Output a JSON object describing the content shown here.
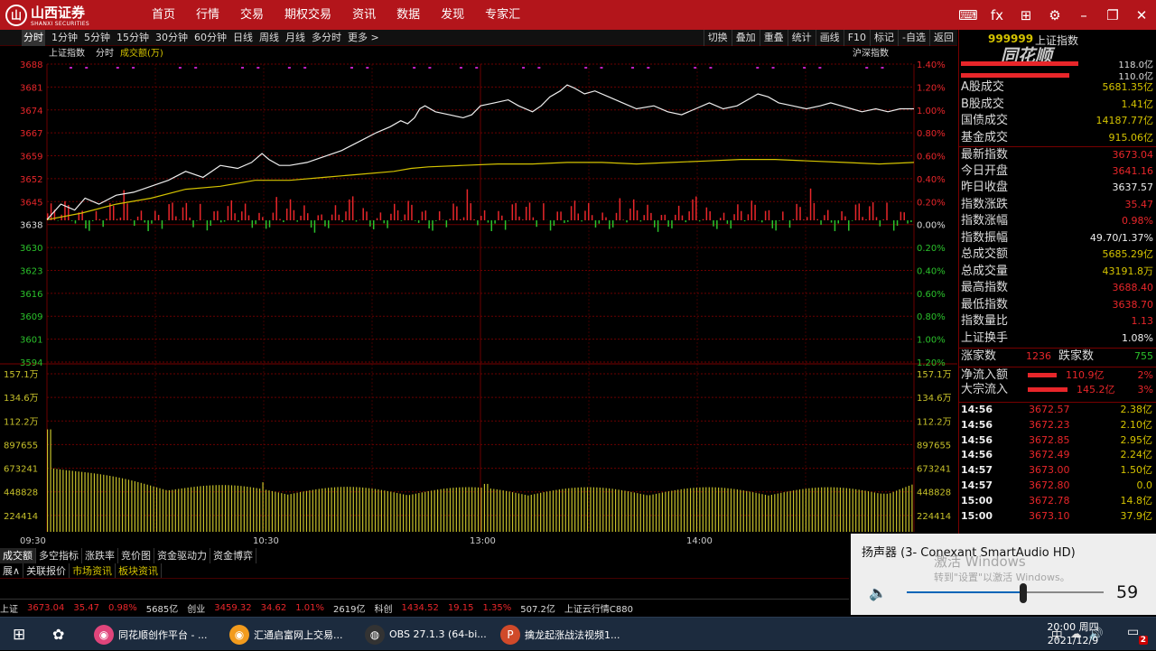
{
  "app": {
    "logo_mark": "山",
    "logo_name": "山西证券",
    "logo_sub": "SHANXI SECURITIES"
  },
  "nav": [
    "首页",
    "行情",
    "交易",
    "期权交易",
    "资讯",
    "数据",
    "发现",
    "专家汇"
  ],
  "top_icons": [
    "keyboard-icon",
    "fx-icon",
    "grid-icon",
    "gear-icon",
    "minimize-icon",
    "restore-icon",
    "close-icon"
  ],
  "top_icon_glyphs": [
    "⌨",
    "fx",
    "⊞",
    "⚙",
    "–",
    "❐",
    "✕"
  ],
  "periods": [
    "分时",
    "1分钟",
    "5分钟",
    "15分钟",
    "30分钟",
    "60分钟",
    "日线",
    "周线",
    "月线",
    "多分时",
    "更多 >"
  ],
  "tools": [
    "切换",
    "叠加",
    "重叠",
    "统计",
    "画线",
    "F10",
    "标记",
    "-自选",
    "返回"
  ],
  "chart": {
    "index_name": "上证指数",
    "mode": "分时",
    "vol_label": "成交额(万)",
    "compare_label": "沪深指数"
  },
  "colors": {
    "up": "#e8262a",
    "down": "#2bc12b",
    "vol": "#c7c12a",
    "line_white": "#eeeeee",
    "line_yellow": "#d4c300",
    "grid": "#6b0000"
  },
  "chart_data": {
    "type": "line",
    "title": "上证指数",
    "yaxis_left": [
      "3688",
      "3681",
      "3674",
      "3667",
      "3659",
      "3652",
      "3645",
      "3638",
      "3630",
      "3623",
      "3616",
      "3609",
      "3601",
      "3594"
    ],
    "yaxis_right": [
      "1.40%",
      "1.20%",
      "1.00%",
      "0.80%",
      "0.60%",
      "0.40%",
      "0.20%",
      "0.00%",
      "0.20%",
      "0.40%",
      "0.60%",
      "0.80%",
      "1.00%",
      "1.20%"
    ],
    "vol_axis": [
      "157.1万",
      "134.6万",
      "112.2万",
      "897655",
      "673241",
      "448828",
      "224414"
    ],
    "x_labels": [
      "09:30",
      "10:30",
      "13:00",
      "14:00"
    ],
    "prev_close": 3637.57,
    "ylim": [
      3590,
      3690
    ],
    "price_series": [
      [
        0,
        3637.8
      ],
      [
        8,
        3643
      ],
      [
        16,
        3641
      ],
      [
        22,
        3645
      ],
      [
        30,
        3643
      ],
      [
        40,
        3646
      ],
      [
        50,
        3647
      ],
      [
        60,
        3649
      ],
      [
        70,
        3651
      ],
      [
        80,
        3654
      ],
      [
        90,
        3652
      ],
      [
        100,
        3656
      ],
      [
        110,
        3655
      ],
      [
        118,
        3657
      ],
      [
        124,
        3660
      ],
      [
        128,
        3658
      ],
      [
        134,
        3656
      ],
      [
        140,
        3656
      ],
      [
        150,
        3657
      ],
      [
        160,
        3659
      ],
      [
        170,
        3661
      ],
      [
        180,
        3664
      ],
      [
        190,
        3667
      ],
      [
        198,
        3669
      ],
      [
        204,
        3671
      ],
      [
        208,
        3670
      ],
      [
        212,
        3672
      ],
      [
        215,
        3675
      ],
      [
        218,
        3676
      ],
      [
        224,
        3674
      ],
      [
        232,
        3673
      ],
      [
        240,
        3672
      ],
      [
        245,
        3673
      ],
      [
        250,
        3676
      ],
      [
        258,
        3677
      ],
      [
        266,
        3678
      ],
      [
        272,
        3676
      ],
      [
        280,
        3674
      ],
      [
        285,
        3676
      ],
      [
        290,
        3679
      ],
      [
        296,
        3681
      ],
      [
        300,
        3683
      ],
      [
        304,
        3682
      ],
      [
        310,
        3680
      ],
      [
        316,
        3681
      ],
      [
        324,
        3679
      ],
      [
        332,
        3677
      ],
      [
        340,
        3675
      ],
      [
        350,
        3676
      ],
      [
        358,
        3674
      ],
      [
        366,
        3673
      ],
      [
        374,
        3675
      ],
      [
        382,
        3677
      ],
      [
        390,
        3675
      ],
      [
        398,
        3676
      ],
      [
        404,
        3678
      ],
      [
        410,
        3680
      ],
      [
        416,
        3679
      ],
      [
        422,
        3677
      ],
      [
        430,
        3676
      ],
      [
        438,
        3675
      ],
      [
        446,
        3676
      ],
      [
        452,
        3677
      ],
      [
        458,
        3676
      ],
      [
        464,
        3675
      ],
      [
        470,
        3674
      ],
      [
        478,
        3675
      ],
      [
        485,
        3674
      ],
      [
        492,
        3675
      ],
      [
        500,
        3675
      ]
    ],
    "avg_series": [
      [
        0,
        3637.8
      ],
      [
        20,
        3640
      ],
      [
        40,
        3643
      ],
      [
        60,
        3645
      ],
      [
        80,
        3648
      ],
      [
        100,
        3649
      ],
      [
        120,
        3651
      ],
      [
        140,
        3651
      ],
      [
        160,
        3652
      ],
      [
        180,
        3653
      ],
      [
        200,
        3654
      ],
      [
        210,
        3655
      ],
      [
        220,
        3655.5
      ],
      [
        240,
        3656
      ],
      [
        260,
        3656.5
      ],
      [
        280,
        3656.5
      ],
      [
        300,
        3657
      ],
      [
        320,
        3657
      ],
      [
        340,
        3656.5
      ],
      [
        360,
        3657
      ],
      [
        380,
        3657.5
      ],
      [
        400,
        3658
      ],
      [
        420,
        3658
      ],
      [
        440,
        3657.5
      ],
      [
        460,
        3657
      ],
      [
        480,
        3656.5
      ],
      [
        500,
        3657
      ]
    ]
  },
  "right": {
    "code": "999999",
    "name": "上证指数",
    "brand": "同花顺",
    "bar1_value": "118.0亿",
    "bar2_value": "110.0亿",
    "stats": [
      {
        "k": "A股成交",
        "v": "5681.35亿",
        "c": "#d4c300"
      },
      {
        "k": "B股成交",
        "v": "1.41亿",
        "c": "#d4c300"
      },
      {
        "k": "国债成交",
        "v": "14187.77亿",
        "c": "#d4c300"
      },
      {
        "k": "基金成交",
        "v": "915.06亿",
        "c": "#d4c300"
      },
      {
        "k": "最新指数",
        "v": "3673.04",
        "c": "#e8262a"
      },
      {
        "k": "今日开盘",
        "v": "3641.16",
        "c": "#e8262a"
      },
      {
        "k": "昨日收盘",
        "v": "3637.57",
        "c": "#eeeeee"
      },
      {
        "k": "指数涨跌",
        "v": "35.47",
        "c": "#e8262a"
      },
      {
        "k": "指数涨幅",
        "v": "0.98%",
        "c": "#e8262a"
      },
      {
        "k": "指数振幅",
        "v": "49.70/1.37%",
        "c": "#eeeeee"
      },
      {
        "k": "总成交额",
        "v": "5685.29亿",
        "c": "#d4c300"
      },
      {
        "k": "总成交量",
        "v": "43191.8万",
        "c": "#d4c300"
      },
      {
        "k": "最高指数",
        "v": "3688.40",
        "c": "#e8262a"
      },
      {
        "k": "最低指数",
        "v": "3638.70",
        "c": "#e8262a"
      },
      {
        "k": "指数量比",
        "v": "1.13",
        "c": "#e8262a"
      },
      {
        "k": "上证换手",
        "v": "1.08%",
        "c": "#eeeeee"
      }
    ],
    "up_label": "涨家数",
    "up_count": "1236",
    "down_label": "跌家数",
    "down_count": "755",
    "net_inflow_label": "净流入额",
    "net_inflow": "110.9亿",
    "net_inflow_pct": "2%",
    "block_inflow_label": "大宗流入",
    "block_inflow": "145.2亿",
    "block_inflow_pct": "3%",
    "ticks": [
      {
        "t": "14:56",
        "p": "3672.57",
        "q": "2.38亿"
      },
      {
        "t": "14:56",
        "p": "3672.23",
        "q": "2.10亿"
      },
      {
        "t": "14:56",
        "p": "3672.85",
        "q": "2.95亿"
      },
      {
        "t": "14:56",
        "p": "3672.49",
        "q": "2.24亿"
      },
      {
        "t": "14:57",
        "p": "3673.00",
        "q": "1.50亿"
      },
      {
        "t": "14:57",
        "p": "3672.80",
        "q": "0.0"
      },
      {
        "t": "15:00",
        "p": "3672.78",
        "q": "14.8亿"
      },
      {
        "t": "15:00",
        "p": "3673.10",
        "q": "37.9亿"
      }
    ]
  },
  "tabs1": [
    "成交额",
    "多空指标",
    "涨跌率",
    "竞价图",
    "资金驱动力",
    "资金博弈"
  ],
  "tabs2": [
    "展∧",
    "关联报价",
    "市场资讯",
    "板块资讯"
  ],
  "status": [
    {
      "v": "上证",
      "c": "#ddd"
    },
    {
      "v": "3673.04",
      "c": "#e8262a"
    },
    {
      "v": "35.47",
      "c": "#e8262a"
    },
    {
      "v": "0.98%",
      "c": "#e8262a"
    },
    {
      "v": "5685亿",
      "c": "#ddd"
    },
    {
      "v": "创业",
      "c": "#ddd"
    },
    {
      "v": "3459.32",
      "c": "#e8262a"
    },
    {
      "v": "34.62",
      "c": "#e8262a"
    },
    {
      "v": "1.01%",
      "c": "#e8262a"
    },
    {
      "v": "2619亿",
      "c": "#ddd"
    },
    {
      "v": "科创",
      "c": "#ddd"
    },
    {
      "v": "1434.52",
      "c": "#e8262a"
    },
    {
      "v": "19.15",
      "c": "#e8262a"
    },
    {
      "v": "1.35%",
      "c": "#e8262a"
    },
    {
      "v": "507.2亿",
      "c": "#ddd"
    },
    {
      "v": "上证云行情C880",
      "c": "#ddd"
    }
  ],
  "volume_popup": {
    "title": "扬声器 (3- Conexant SmartAudio HD)",
    "watermark1": "激活 Windows",
    "watermark2": "转到\"设置\"以激活 Windows。",
    "value": "59",
    "level": 0.59
  },
  "taskbar": {
    "apps": [
      {
        "label": "同花顺创作平台 - ...",
        "color": "#e0457b",
        "glyph": "◉"
      },
      {
        "label": "汇通启富网上交易...",
        "color": "#f29b1d",
        "glyph": "◉"
      },
      {
        "label": "OBS 27.1.3 (64-bi...",
        "color": "#333",
        "glyph": "◍"
      },
      {
        "label": "擒龙起涨战法视频1...",
        "color": "#d04a2a",
        "glyph": "P"
      }
    ],
    "tray": [
      "中",
      "☁",
      "🔊"
    ],
    "time": "20:00 周四",
    "date": "2021/12/9",
    "notif_count": "2"
  }
}
